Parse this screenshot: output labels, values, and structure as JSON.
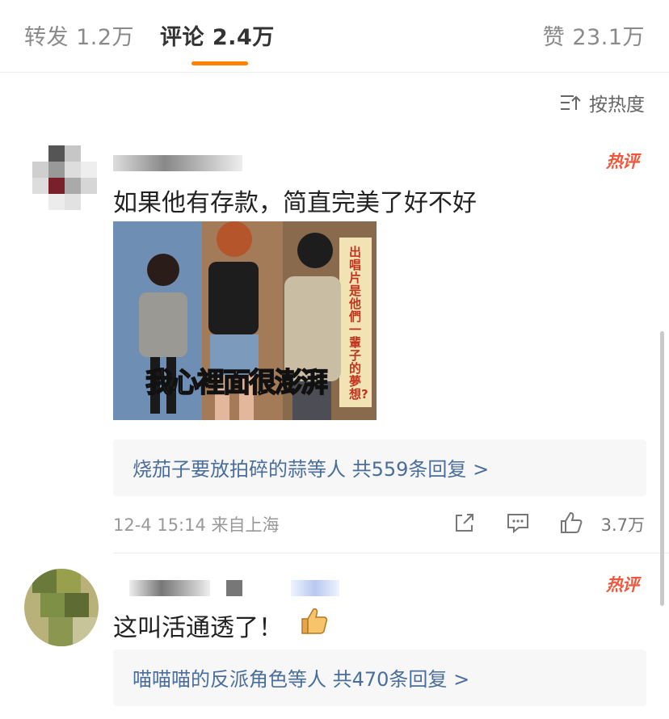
{
  "tabs": {
    "repost": "转发 1.2万",
    "comments": "评论 2.4万",
    "likes": "赞 23.1万"
  },
  "sort": {
    "label": "按热度"
  },
  "comments": [
    {
      "badge": "热评",
      "text": "如果他有存款，简直完美了好不好",
      "image": {
        "caption": "我心裡面很澎湃",
        "side_text": "出唱片是他們一輩子的夢想?"
      },
      "replies": "烧茄子要放拍碎的蒜等人  共559条回复 >",
      "time": "12-4 15:14  来自上海",
      "likes": "3.7万"
    },
    {
      "badge": "热评",
      "text": "这叫活通透了！",
      "emoji": "thumbs-up",
      "replies": "喵喵喵的反派角色等人  共470条回复 >"
    }
  ]
}
